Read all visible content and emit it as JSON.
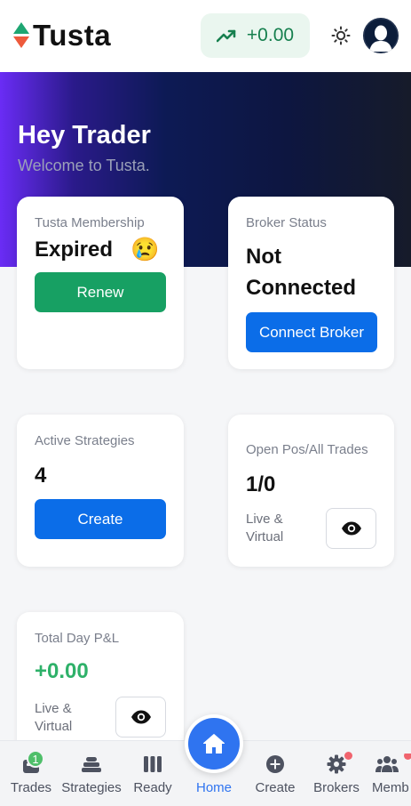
{
  "header": {
    "logo_text": "Tusta",
    "pnl_value": "+0.00"
  },
  "hero": {
    "title": "Hey Trader",
    "subtitle": "Welcome to Tusta."
  },
  "cards": {
    "membership": {
      "label": "Tusta Membership",
      "status": "Expired",
      "emoji": "😢",
      "button": "Renew"
    },
    "broker": {
      "label": "Broker Status",
      "status_line1": "Not",
      "status_line2": "Connected",
      "button": "Connect Broker"
    },
    "strategies": {
      "label": "Active Strategies",
      "count": "4",
      "button": "Create"
    },
    "positions": {
      "label": "Open Pos/All Trades",
      "value": "1/0",
      "sub_line1": "Live &",
      "sub_line2": "Virtual"
    },
    "day_pnl": {
      "label": "Total Day P&L",
      "value": "+0.00",
      "sub_line1": "Live &",
      "sub_line2": "Virtual"
    }
  },
  "nav": {
    "items": [
      {
        "label": "Trades",
        "badge": "1"
      },
      {
        "label": "Strategies"
      },
      {
        "label": "Ready"
      },
      {
        "label": "Home"
      },
      {
        "label": "Create"
      },
      {
        "label": "Brokers"
      },
      {
        "label": "Memb"
      }
    ]
  },
  "colors": {
    "accent_green": "#17a063",
    "accent_blue": "#0b6de8",
    "pnl_text": "#17804f",
    "home_blue": "#2f74f0"
  }
}
